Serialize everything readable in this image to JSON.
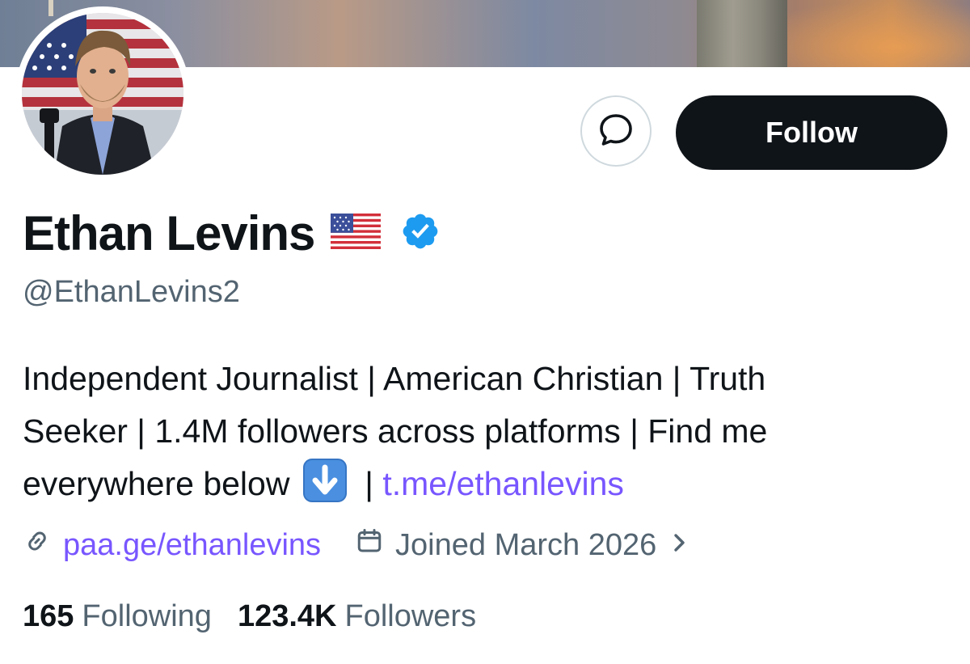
{
  "profile": {
    "display_name": "Ethan Levins",
    "handle": "@EthanLevins2",
    "follow_label": "Follow",
    "bio": {
      "line1": "Independent Journalist | American Christian | Truth",
      "line2": "Seeker | 1.4M followers across platforms | Find me",
      "line3_text": "everywhere below",
      "line3_sep": "|",
      "line3_link": "t.me/ethanlevins"
    },
    "website": "paa.ge/ethanlevins",
    "joined": "Joined March 2026",
    "stats": {
      "following_count": "165",
      "following_label": "Following",
      "followers_count": "123.4K",
      "followers_label": "Followers"
    }
  },
  "icons": {
    "message": "message-bubble-icon",
    "flag": "us-flag-emoji-icon",
    "verified": "verified-badge-icon",
    "down_arrow": "down-arrow-emoji-icon",
    "link": "link-icon",
    "calendar": "calendar-icon",
    "chevron": "chevron-right-icon"
  },
  "colors": {
    "text": "#0f1419",
    "secondary": "#536471",
    "link": "#7856ff",
    "verified": "#1d9bf0",
    "follow_button": "#0f1419"
  }
}
